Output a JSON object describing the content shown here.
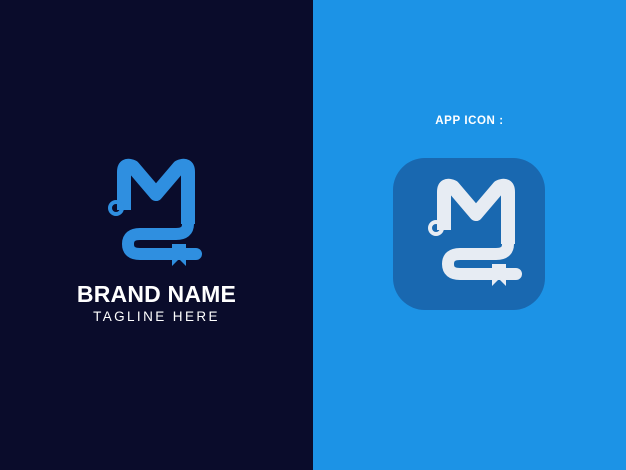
{
  "brand": {
    "name": "BRAND NAME",
    "tagline": "TAGLINE HERE"
  },
  "app_icon": {
    "label": "APP ICON :"
  },
  "colors": {
    "left_background": "#0a0c2b",
    "right_background": "#1c93e6",
    "logo_blue": "#2f8fe0",
    "app_icon_background": "#1968b0",
    "app_icon_mark": "#e7ecf3",
    "text": "#ffffff"
  },
  "icons": {
    "logo_mark": "mc-book-monogram-icon"
  }
}
